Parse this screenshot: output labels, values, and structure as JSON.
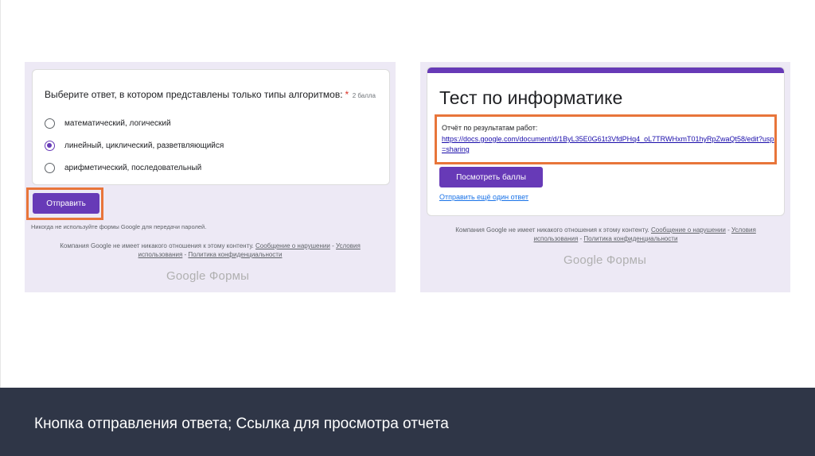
{
  "left": {
    "question": "Выберите ответ, в котором представлены только типы алгоритмов:",
    "required_mark": "*",
    "points": "2 балла",
    "options": [
      "математический, логический",
      "линейный, циклический, разветвляющийся",
      "арифметический, последовательный"
    ],
    "selected_option": "линейный, циклический, разветвляющийся",
    "submit_label": "Отправить",
    "never_note": "Никогда не используйте формы Google для передачи паролей.",
    "footer": {
      "prefix": "Компания Google не имеет никакого отношения к этому контенту.",
      "report_abuse": "Сообщение о нарушении",
      "sep1": " - ",
      "terms": "Условия использования",
      "sep2": " - ",
      "privacy": "Политика конфиденциальности"
    },
    "brand": "Google Формы"
  },
  "right": {
    "title": "Тест по информатике",
    "report_label": "Отчёт по результатам работ:",
    "report_url": "https://docs.google.com/document/d/1ByL35E0G61t3VfdPHq4_oL7TRWHxmT01hyRpZwaQt58/edit?usp=sharing",
    "view_scores_label": "Посмотреть баллы",
    "submit_another_label": "Отправить ещё один ответ",
    "footer": {
      "prefix": "Компания Google не имеет никакого отношения к этому контенту.",
      "report_abuse": "Сообщение о нарушении",
      "sep1": " - ",
      "terms": "Условия использования",
      "sep2": " - ",
      "privacy": "Политика конфиденциальности"
    },
    "brand": "Google Формы"
  },
  "caption": "Кнопка отправления ответа; Ссылка для просмотра отчета",
  "colors": {
    "accent": "#673ab7",
    "highlight": "#e8753a",
    "band": "#2f3647",
    "form_bg": "#ede9f5"
  }
}
